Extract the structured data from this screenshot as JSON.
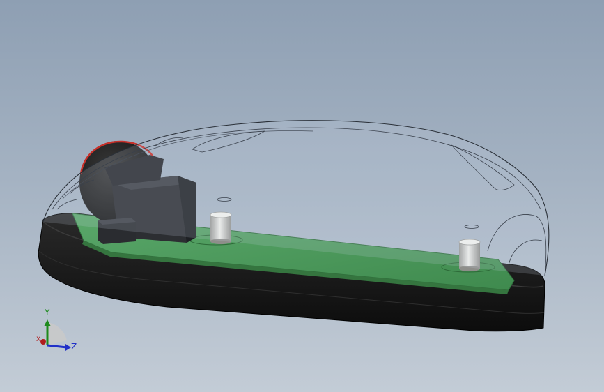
{
  "viewport": {
    "background_top": "#8e9fb3",
    "background_bottom": "#c3ccd6"
  },
  "model": {
    "shell_color": "#141414",
    "pcb_color": "#4a9a5a",
    "wheel_color": "#1e1e1e",
    "wheel_rim_color": "#c8302a",
    "standoff_color": "#d8d8d4",
    "cover_edge_color": "#2a3038"
  },
  "triad": {
    "y_label": "Y",
    "z_label": "Z",
    "x_label": "X",
    "y_color": "#1d8a1d",
    "z_color": "#2030c8",
    "x_color": "#b01c1c"
  }
}
